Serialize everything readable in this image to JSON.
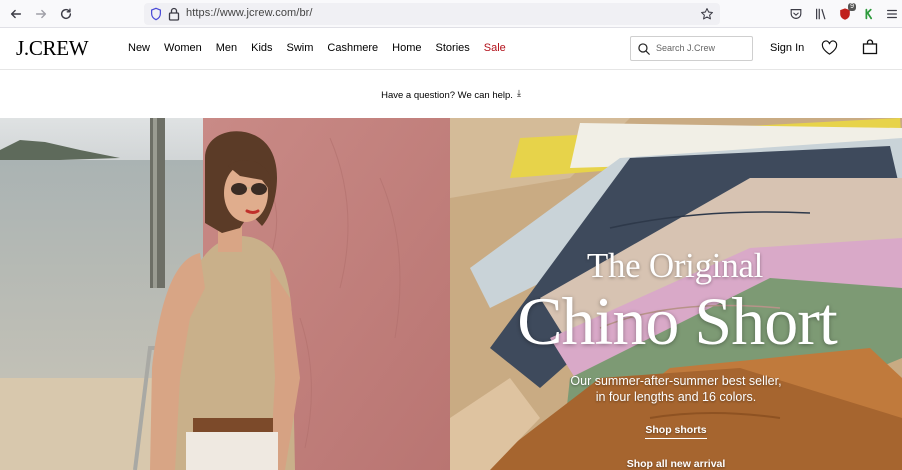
{
  "browser": {
    "url": "https://www.jcrew.com/br/",
    "extension_badge": "9"
  },
  "header": {
    "logo": "J.CREW",
    "nav": [
      {
        "label": "New"
      },
      {
        "label": "Women"
      },
      {
        "label": "Men"
      },
      {
        "label": "Kids"
      },
      {
        "label": "Swim"
      },
      {
        "label": "Cashmere"
      },
      {
        "label": "Home"
      },
      {
        "label": "Stories"
      },
      {
        "label": "Sale",
        "highlight": "#b2101a"
      }
    ],
    "search_placeholder": "Search J.Crew",
    "sign_in": "Sign In"
  },
  "promo": {
    "text": "Have a question? We can help."
  },
  "hero": {
    "kicker": "The Original",
    "title": "Chino Short",
    "subtitle_line1": "Our summer-after-summer best seller,",
    "subtitle_line2": "in four lengths and 16 colors.",
    "cta_primary": "Shop shorts",
    "cta_secondary": "Shop all new arrival"
  },
  "colors": {
    "sale": "#b2101a",
    "pink_wall": "#c98a86",
    "sand": "#c7a87e"
  }
}
